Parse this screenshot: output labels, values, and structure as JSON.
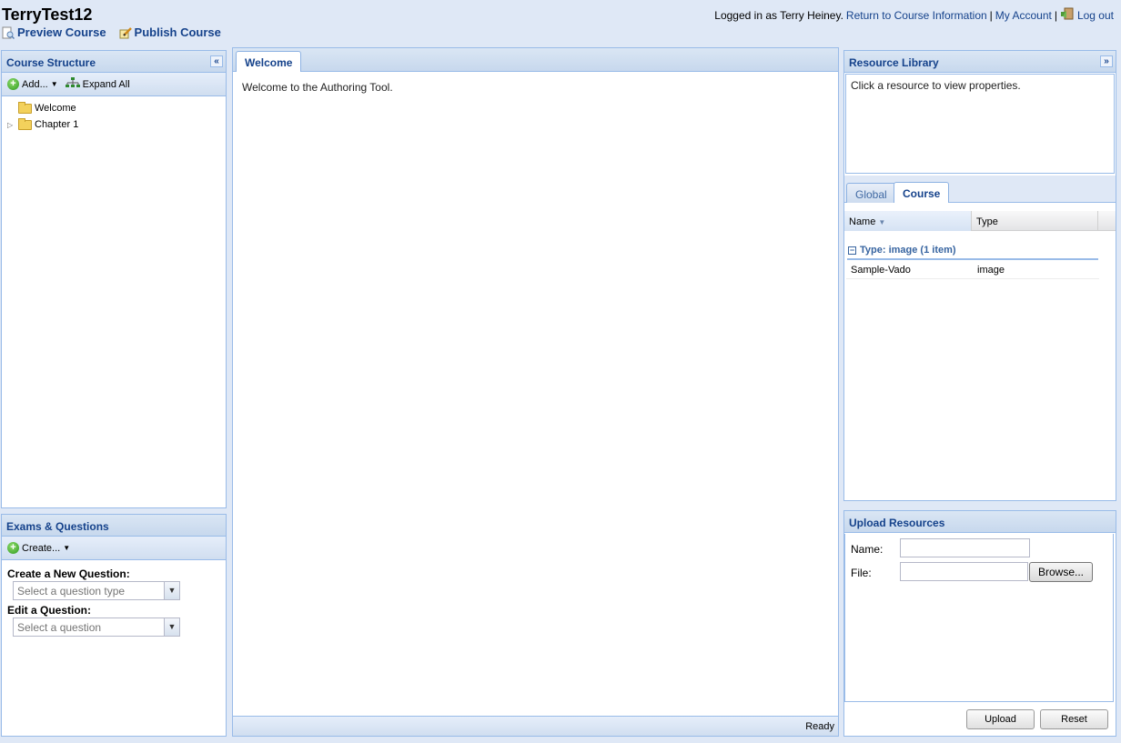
{
  "header": {
    "course_title": "TerryTest12",
    "preview_label": "Preview Course",
    "publish_label": "Publish Course",
    "logged_in_text": "Logged in as Terry Heiney.",
    "return_link": "Return to Course Information",
    "separator": "|",
    "account_link": "My Account",
    "logout_link": "Log out"
  },
  "course_structure": {
    "title": "Course Structure",
    "collapse_glyph": "«",
    "add_label": "Add...",
    "expand_all_label": "Expand All",
    "items": [
      {
        "label": "Welcome",
        "expandable": false
      },
      {
        "label": "Chapter 1",
        "expandable": true
      }
    ]
  },
  "exams": {
    "title": "Exams & Questions",
    "create_label": "Create...",
    "new_question_label": "Create a New Question:",
    "new_question_placeholder": "Select a question type",
    "edit_question_label": "Edit a Question:",
    "edit_question_placeholder": "Select a question"
  },
  "center": {
    "tab_label": "Welcome",
    "content_text": "Welcome to the Authoring Tool.",
    "status_text": "Ready"
  },
  "resource_library": {
    "title": "Resource Library",
    "expand_glyph": "»",
    "properties_hint": "Click a resource to view properties.",
    "tabs": [
      "Global",
      "Course"
    ],
    "active_tab": "Course",
    "columns": [
      "Name",
      "Type"
    ],
    "group_label": "Type: image (1 item)",
    "group_toggle": "−",
    "rows": [
      {
        "name": "Sample-Vado",
        "type": "image"
      }
    ]
  },
  "upload": {
    "title": "Upload Resources",
    "name_label": "Name:",
    "file_label": "File:",
    "browse_label": "Browse...",
    "upload_label": "Upload",
    "reset_label": "Reset"
  },
  "icons": {
    "preview": "page-magnifier-icon",
    "publish": "pencil-page-icon",
    "logout": "exit-door-icon",
    "add": "green-plus-icon",
    "expand_all": "tree-hierarchy-icon",
    "folder": "folder-icon"
  }
}
